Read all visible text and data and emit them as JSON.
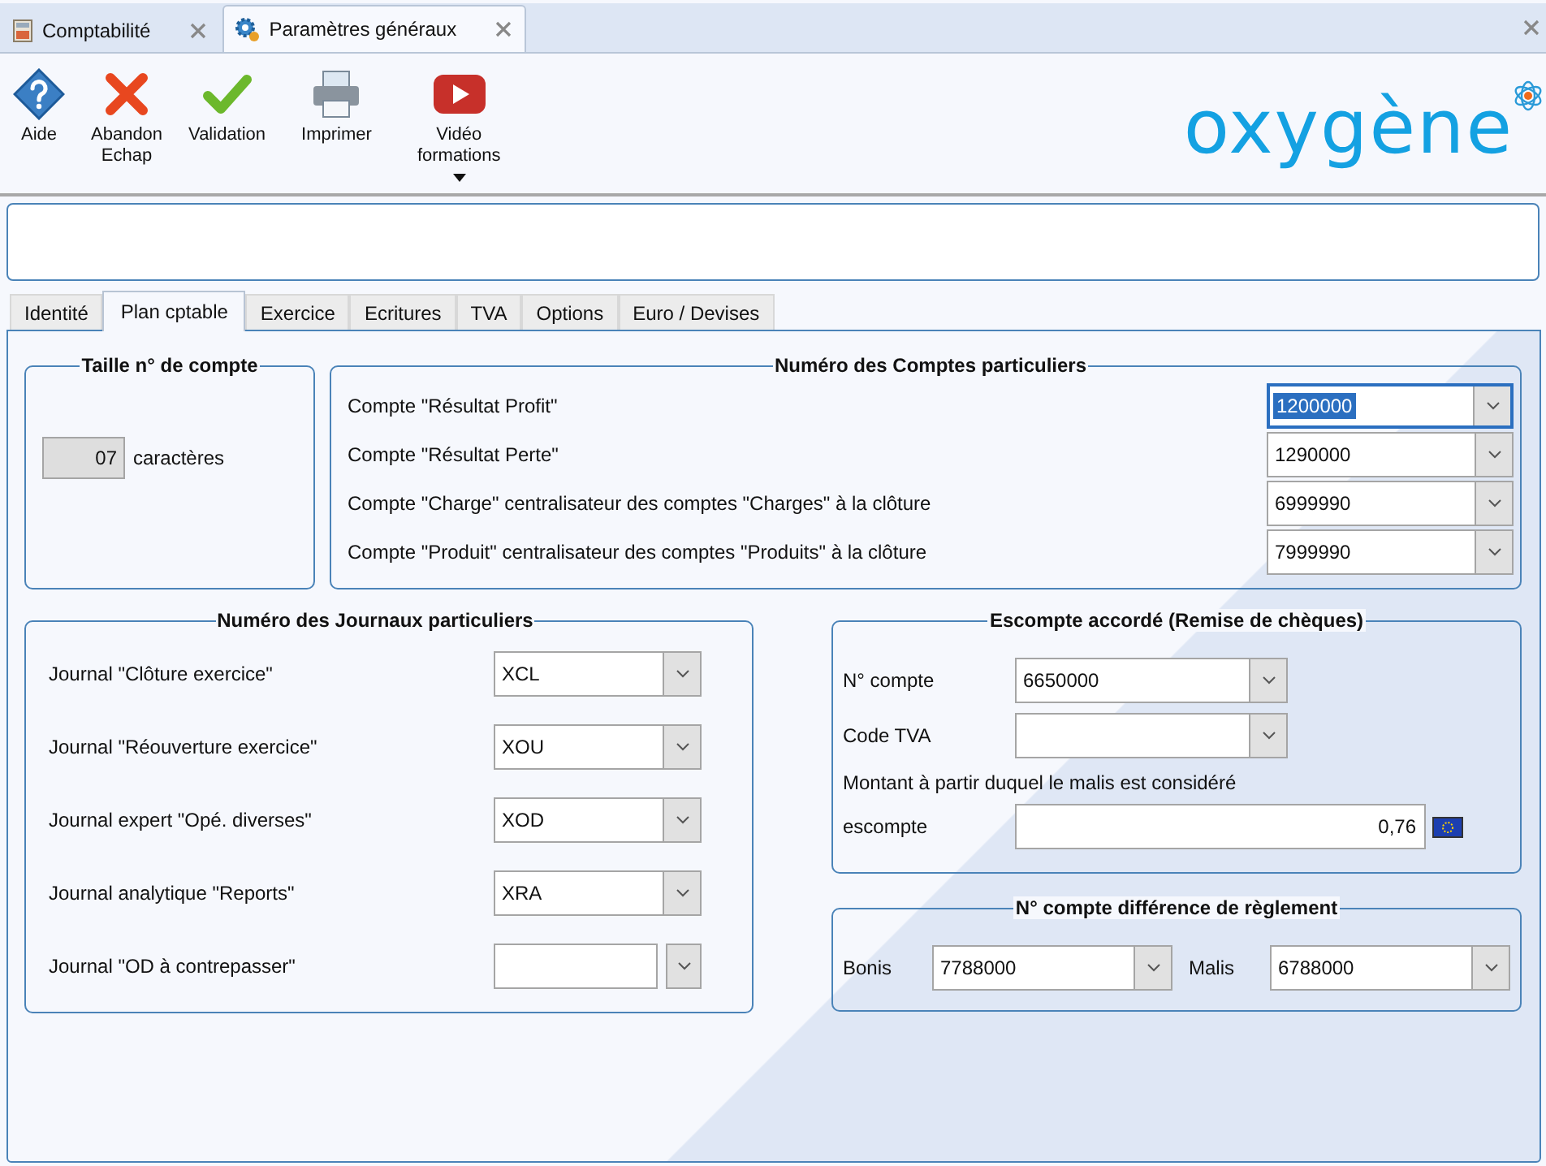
{
  "doc_tabs": [
    {
      "label": "Comptabilité",
      "kind": "calculator",
      "selected": false
    },
    {
      "label": "Paramètres généraux",
      "kind": "gears",
      "selected": true
    }
  ],
  "toolbar": [
    {
      "label": "Aide",
      "kind": "help"
    },
    {
      "label": "Abandon\nEchap",
      "kind": "cancel"
    },
    {
      "label": "Validation",
      "kind": "check"
    },
    {
      "label": "Imprimer",
      "kind": "print"
    },
    {
      "label": "Vidéo\nformations",
      "kind": "video",
      "dropdown": true
    }
  ],
  "logo": {
    "text": "oxygène"
  },
  "tabs": [
    {
      "label": "Identité",
      "selected": false
    },
    {
      "label": "Plan cptable",
      "selected": true
    },
    {
      "label": "Exercice",
      "selected": false
    },
    {
      "label": "Ecritures",
      "selected": false
    },
    {
      "label": "TVA",
      "selected": false
    },
    {
      "label": "Options",
      "selected": false
    },
    {
      "label": "Euro / Devises",
      "selected": false
    }
  ],
  "taille": {
    "title": "Taille n° de compte",
    "value": "07",
    "unit": "caractères"
  },
  "comptes": {
    "title": "Numéro des Comptes particuliers",
    "rows": [
      {
        "label": "Compte \"Résultat Profit\"",
        "value": "1200000",
        "focused": true
      },
      {
        "label": "Compte \"Résultat Perte\"",
        "value": "1290000",
        "focused": false
      },
      {
        "label": "Compte \"Charge\" centralisateur des comptes \"Charges\" à la clôture",
        "value": "6999990",
        "focused": false
      },
      {
        "label": "Compte \"Produit\" centralisateur des comptes \"Produits\" à la clôture",
        "value": "7999990",
        "focused": false
      }
    ]
  },
  "journaux": {
    "title": "Numéro des Journaux particuliers",
    "rows": [
      {
        "label": "Journal \"Clôture exercice\"",
        "value": "XCL"
      },
      {
        "label": "Journal \"Réouverture exercice\"",
        "value": "XOU"
      },
      {
        "label": "Journal expert \"Opé. diverses\"",
        "value": "XOD"
      },
      {
        "label": "Journal analytique \"Reports\"",
        "value": "XRA"
      },
      {
        "label": "Journal \"OD à contrepasser\"",
        "value": ""
      }
    ]
  },
  "escompte": {
    "title": "Escompte accordé (Remise de chèques)",
    "compte_label": "N° compte",
    "compte_value": "6650000",
    "tva_label": "Code TVA",
    "note": "Montant à partir duquel le malis est considéré",
    "amount_label": "escompte",
    "amount_value": "0,76"
  },
  "difference": {
    "title": "N° compte différence de règlement",
    "bonis_label": "Bonis",
    "bonis_value": "7788000",
    "malis_label": "Malis",
    "malis_value": "6788000"
  }
}
